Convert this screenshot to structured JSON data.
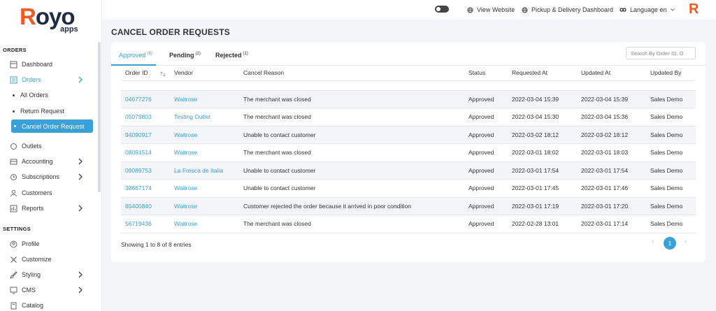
{
  "brand": {
    "logo_main": "Royo",
    "logo_first": "R",
    "logo_rest": "oyo",
    "logo_sub": "apps",
    "short_logo": "R"
  },
  "topbar": {
    "view_website": "View Website",
    "pickup_dashboard": "Pickup & Delivery Dashboard",
    "language": "Language en"
  },
  "sidebar": {
    "orders_section": "ORDERS",
    "settings_section": "SETTINGS",
    "items": {
      "dashboard": "Dashboard",
      "orders": "Orders",
      "all_orders": "All Orders",
      "return_request": "Return Request",
      "cancel_order_request": "Cancel Order Request",
      "outlets": "Outlets",
      "accounting": "Accounting",
      "subscriptions": "Subscriptions",
      "customers": "Customers",
      "reports": "Reports",
      "profile": "Profile",
      "customize": "Customize",
      "styling": "Styling",
      "cms": "CMS",
      "catalog": "Catalog"
    }
  },
  "page": {
    "title": "CANCEL ORDER REQUESTS"
  },
  "tabs": [
    {
      "label": "Approved",
      "count": "(8)"
    },
    {
      "label": "Pending",
      "count": "(2)"
    },
    {
      "label": "Rejected",
      "count": "(1)"
    }
  ],
  "search": {
    "placeholder": "Search By Order ID, O"
  },
  "table": {
    "headers": [
      "Order ID",
      "Vendor",
      "Cancel Reason",
      "Status",
      "Requested At",
      "Updated At",
      "Updated By"
    ],
    "rows": [
      [
        "04677276",
        "Waitrose",
        "The merchant was closed",
        "Approved",
        "2022-03-04 15:39",
        "2022-03-04 15:39",
        "Sales Demo"
      ],
      [
        "05079803",
        "Testing Outlet",
        "The merchant was closed",
        "Approved",
        "2022-03-04 15:30",
        "2022-03-04 15:36",
        "Sales Demo"
      ],
      [
        "94090917",
        "Waitrose",
        "Unable to contact customer",
        "Approved",
        "2022-03-02 18:12",
        "2022-03-02 18:12",
        "Sales Demo"
      ],
      [
        "08091514",
        "Waitrose",
        "The merchant was closed",
        "Approved",
        "2022-03-01 18:02",
        "2022-03-01 18:03",
        "Sales Demo"
      ],
      [
        "09089753",
        "La Fresca de Italia",
        "Unable to contact customer",
        "Approved",
        "2022-03-01 17:54",
        "2022-03-01 17:54",
        "Sales Demo"
      ],
      [
        "38667174",
        "Waitrose",
        "Unable to contact customer",
        "Approved",
        "2022-03-01 17:45",
        "2022-03-01 17:46",
        "Sales Demo"
      ],
      [
        "65400840",
        "Waitrose",
        "Customer rejected the order because it arrived in poor condition",
        "Approved",
        "2022-03-01 17:19",
        "2022-03-01 17:20",
        "Sales Demo"
      ],
      [
        "56719436",
        "Waitrose",
        "The merchant was closed",
        "Approved",
        "2022-02-28 13:01",
        "2022-03-01 17:14",
        "Sales Demo"
      ]
    ]
  },
  "footer": {
    "entries": "Showing 1 to 8 of 8 entries",
    "prev": "‹",
    "next": "›",
    "current_page": "1"
  },
  "colors": {
    "accent": "#3aa0d8",
    "brand": "#f15a24",
    "brand_dark": "#1f2a44"
  }
}
